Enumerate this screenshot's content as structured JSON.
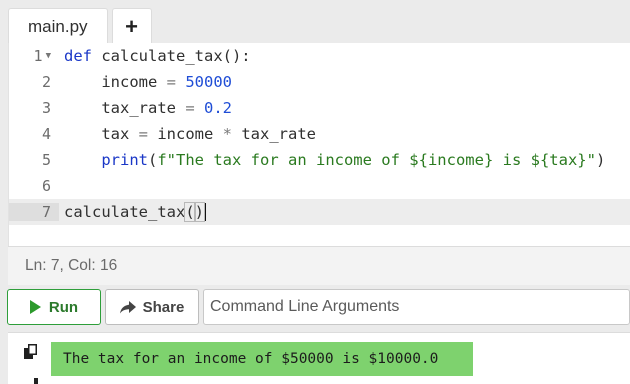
{
  "tabs": {
    "file_label": "main.py",
    "add_label": "+"
  },
  "editor": {
    "gutter_numbers": [
      "1",
      "2",
      "3",
      "4",
      "5",
      "6",
      "7"
    ],
    "active_line": 7,
    "code_tokens": {
      "l1_kw": "def",
      "l1_rest": " calculate_tax():",
      "l2_var": "income",
      "l2_eq": " = ",
      "l2_num": "50000",
      "l3_var": "tax_rate",
      "l3_eq": " = ",
      "l3_num": "0.2",
      "l4_var": "tax",
      "l4_eq": " = ",
      "l4_a": "income",
      "l4_op": " * ",
      "l4_b": "tax_rate",
      "l5_fn": "print",
      "l5_open": "(",
      "l5_str": "f\"The tax for an income of ${income} is ${tax}\"",
      "l5_close": ")",
      "l7_fn": "calculate_tax",
      "l7_open": "(",
      "l7_close": ")"
    }
  },
  "status": {
    "cursor_position": "Ln: 7,  Col: 16"
  },
  "toolbar": {
    "run_label": "Run",
    "share_label": "Share",
    "args_placeholder": "Command Line Arguments"
  },
  "output": {
    "text": "The tax for an income of $50000 is $10000.0"
  },
  "colors": {
    "run_accent": "#2e9e3a",
    "output_bg": "#7ed26e",
    "keyword": "#1a37c7",
    "string": "#2a7a1f"
  },
  "icons": [
    "play-icon",
    "share-icon",
    "copy-icon",
    "fold-arrow-icon"
  ]
}
